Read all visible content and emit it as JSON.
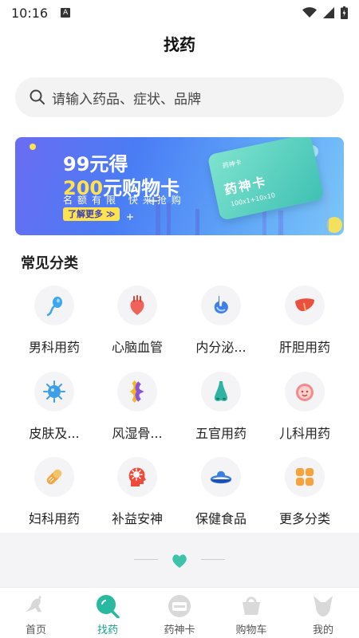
{
  "status_bar": {
    "time": "10:16",
    "badge": "A"
  },
  "header": {
    "title": "找药"
  },
  "search": {
    "placeholder": "请输入药品、症状、品牌"
  },
  "banner": {
    "line1": "99元得",
    "line2_amount": "200",
    "line2_rest": "元购物卡",
    "line3": "名额有限 快来抢购",
    "button": "了解更多 ≫",
    "card_name": "药神卡",
    "card_kind": "药神卡",
    "card_number": "100x1+10x10"
  },
  "categories": {
    "title": "常见分类",
    "items": [
      {
        "label": "男科用药",
        "icon": "sperm-icon"
      },
      {
        "label": "心脑血管",
        "icon": "heart-icon"
      },
      {
        "label": "内分泌...",
        "icon": "stomach-icon"
      },
      {
        "label": "肝胆用药",
        "icon": "liver-icon"
      },
      {
        "label": "皮肤及...",
        "icon": "virus-icon"
      },
      {
        "label": "风湿骨...",
        "icon": "bone-joint-icon"
      },
      {
        "label": "五官用药",
        "icon": "nose-icon"
      },
      {
        "label": "儿科用药",
        "icon": "baby-face-icon"
      },
      {
        "label": "妇科用药",
        "icon": "pill-icon"
      },
      {
        "label": "补益安神",
        "icon": "brain-head-icon"
      },
      {
        "label": "保健食品",
        "icon": "health-food-icon"
      },
      {
        "label": "更多分类",
        "icon": "grid-icon"
      }
    ]
  },
  "tabbar": {
    "items": [
      {
        "label": "首页",
        "icon": "kangaroo-icon",
        "active": false
      },
      {
        "label": "找药",
        "icon": "search-icon",
        "active": true
      },
      {
        "label": "药神卡",
        "icon": "card-icon",
        "active": false
      },
      {
        "label": "购物车",
        "icon": "cart-icon",
        "active": false
      },
      {
        "label": "我的",
        "icon": "profile-icon",
        "active": false
      }
    ]
  },
  "colors": {
    "accent": "#1aa08a",
    "banner_yellow": "#ffe34d"
  }
}
